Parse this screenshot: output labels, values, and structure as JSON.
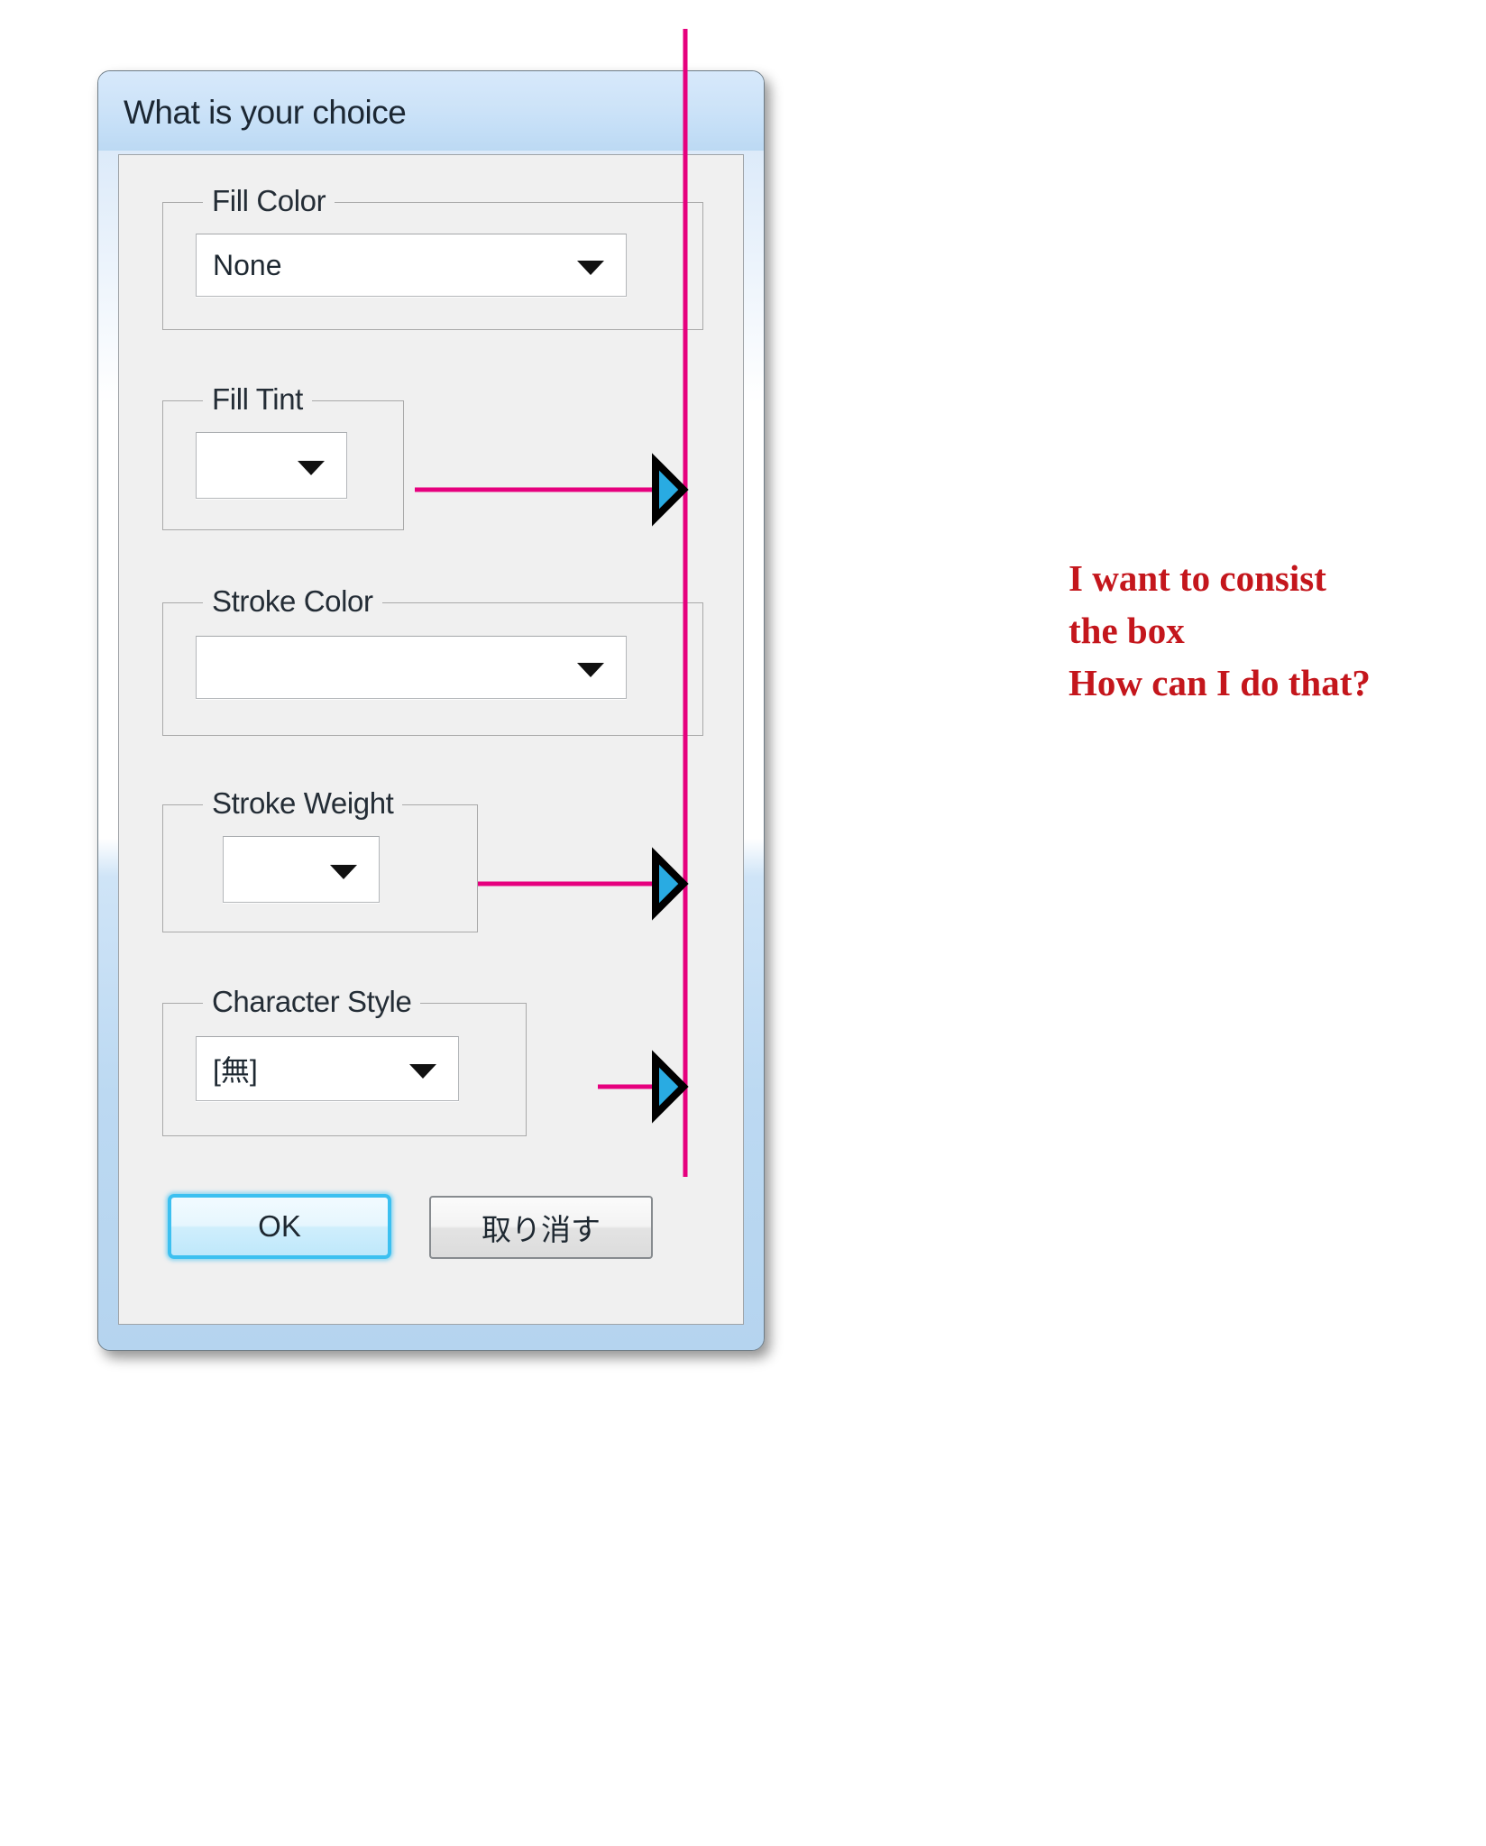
{
  "dialog": {
    "title": "What is your choice",
    "groups": [
      {
        "label": "Fill Color",
        "value": "None",
        "placeholder": ""
      },
      {
        "label": "Fill Tint",
        "value": "",
        "placeholder": ""
      },
      {
        "label": "Stroke Color",
        "value": "",
        "placeholder": ""
      },
      {
        "label": "Stroke Weight",
        "value": "",
        "placeholder": ""
      },
      {
        "label": "Character Style",
        "value": "[無]",
        "placeholder": ""
      }
    ],
    "buttons": {
      "ok_label": "OK",
      "cancel_label": "取り消す"
    }
  },
  "annotation": {
    "text": "I want to consist\nthe box\nHow can I do that?",
    "text_color": "#c4161c",
    "line_color": "#e6007e",
    "arrow_fill_color": "#29abe2",
    "arrow_outline_color": "#000000"
  },
  "icons": {
    "dropdown_arrow": "chevron-down-icon",
    "callout_arrow": "arrow-right-icon"
  }
}
